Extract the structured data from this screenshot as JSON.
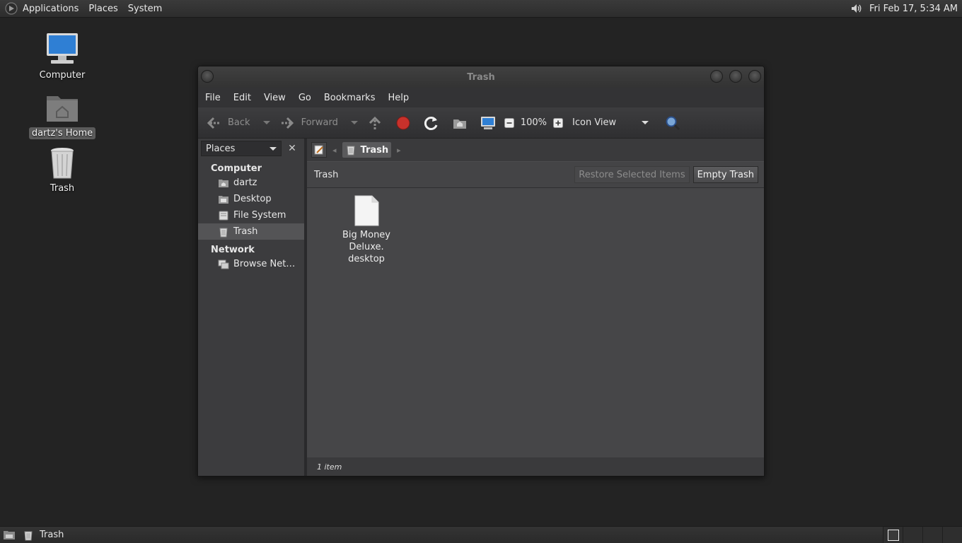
{
  "top_panel": {
    "menus": [
      "Applications",
      "Places",
      "System"
    ],
    "clock": "Fri Feb 17,  5:34 AM"
  },
  "desktop": {
    "icons": [
      {
        "label": "Computer",
        "icon": "computer-icon"
      },
      {
        "label": "dartz's Home",
        "icon": "home-folder-icon",
        "selected": true
      },
      {
        "label": "Trash",
        "icon": "trash-icon"
      }
    ]
  },
  "window": {
    "title": "Trash",
    "menubar": [
      "File",
      "Edit",
      "View",
      "Go",
      "Bookmarks",
      "Help"
    ],
    "toolbar": {
      "back": "Back",
      "forward": "Forward",
      "zoom": "100%",
      "view_mode": "Icon View"
    },
    "sidebar": {
      "selector": "Places",
      "sections": [
        {
          "title": "Computer",
          "items": [
            "dartz",
            "Desktop",
            "File System",
            "Trash"
          ]
        },
        {
          "title": "Network",
          "items": [
            "Browse Net…"
          ]
        }
      ],
      "active_item": "Trash"
    },
    "pathbar": {
      "crumb": "Trash"
    },
    "trash_bar": {
      "title": "Trash",
      "restore_label": "Restore Selected Items",
      "empty_label": "Empty Trash"
    },
    "files": [
      {
        "line1": "Big Money Deluxe.",
        "line2": "desktop"
      }
    ],
    "status": "1 item"
  },
  "bottom_panel": {
    "task_label": "Trash"
  },
  "colors": {
    "desktop_bg": "#232323",
    "window_bg": "#3a3a3c",
    "icon_area_bg": "#464648",
    "stop_red": "#c8312b"
  }
}
